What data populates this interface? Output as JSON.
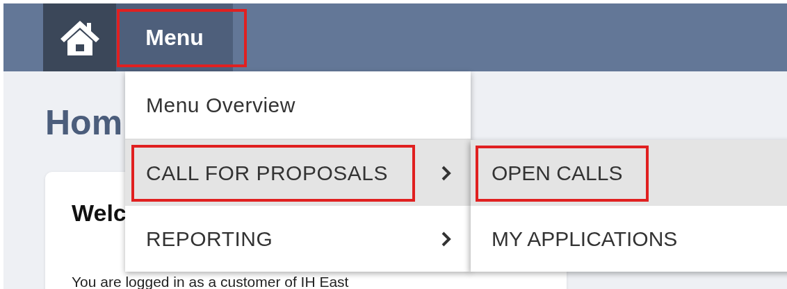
{
  "top_bar": {
    "menu_button": {
      "label": "Menu",
      "selected": true,
      "highlighted": true
    }
  },
  "page": {
    "heading": "Hom",
    "card": {
      "title": "Welc",
      "text": "You are logged in as a customer of IH East"
    }
  },
  "menu": {
    "items": [
      {
        "label": "Menu Overview",
        "has_submenu": false,
        "selected": false,
        "highlighted": false
      },
      {
        "label": "CALL FOR PROPOSALS",
        "has_submenu": true,
        "selected": true,
        "highlighted": true
      },
      {
        "label": "REPORTING",
        "has_submenu": true,
        "selected": false,
        "highlighted": false
      }
    ],
    "submenu": [
      {
        "label": "OPEN CALLS",
        "selected": true,
        "highlighted": true
      },
      {
        "label": "MY APPLICATIONS",
        "selected": false,
        "highlighted": false
      }
    ]
  }
}
